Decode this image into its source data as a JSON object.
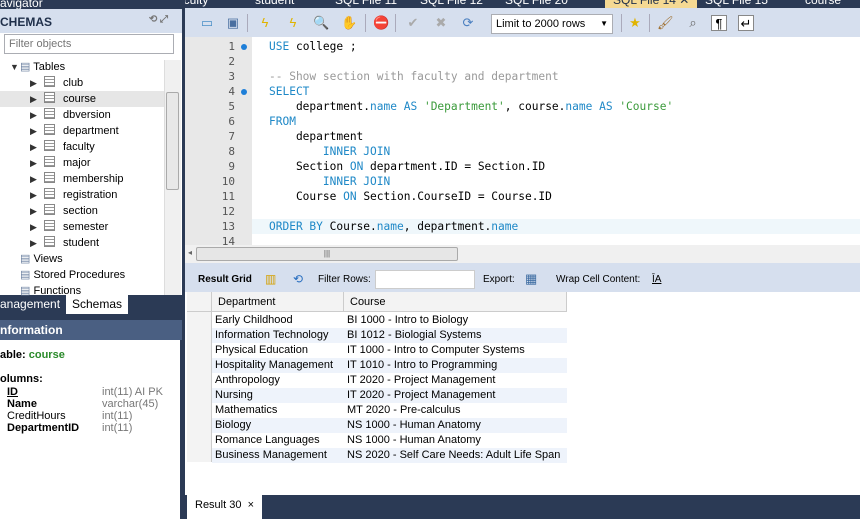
{
  "navigator": {
    "title": "avigator",
    "schemas_label": "CHEMAS",
    "filter_placeholder": "Filter objects",
    "tables_label": "Tables",
    "tables": [
      "club",
      "course",
      "dbversion",
      "department",
      "faculty",
      "major",
      "membership",
      "registration",
      "section",
      "semester",
      "student"
    ],
    "selected_table": "course",
    "other_nodes": [
      "Views",
      "Stored Procedures",
      "Functions"
    ],
    "tabs": [
      "anagement",
      "Schemas"
    ],
    "active_tab": "Schemas"
  },
  "information": {
    "title": "nformation",
    "table_label": "able:",
    "table_name": "course",
    "columns_label": "olumns:",
    "columns": [
      {
        "name": "ID",
        "type": "int(11) AI PK",
        "bold": true,
        "underline": true
      },
      {
        "name": "Name",
        "type": "varchar(45)",
        "bold": true
      },
      {
        "name": "CreditHours",
        "type": "int(11)",
        "bold": false
      },
      {
        "name": "DepartmentID",
        "type": "int(11)",
        "bold": true
      }
    ]
  },
  "editor_tabs": [
    "aculty",
    "student",
    "SQL File 11",
    "SQL File 12",
    "SQL File 20",
    "SQL File 14",
    "SQL File 15",
    "course"
  ],
  "active_editor_tab": "SQL File 14",
  "toolbar": {
    "limit": "Limit to 2000 rows"
  },
  "code": [
    [
      [
        "USE",
        "kw"
      ],
      [
        " college ;",
        "id"
      ]
    ],
    [],
    [
      [
        "-- Show section with faculty and department",
        "cm"
      ]
    ],
    [
      [
        "SELECT",
        "kw"
      ]
    ],
    [
      [
        "    department.",
        "id"
      ],
      [
        "name",
        "fn"
      ],
      [
        " AS ",
        "kw"
      ],
      [
        "'Department'",
        "st"
      ],
      [
        ", course.",
        "id"
      ],
      [
        "name",
        "fn"
      ],
      [
        " AS ",
        "kw"
      ],
      [
        "'Course'",
        "st"
      ]
    ],
    [
      [
        "FROM",
        "kw"
      ]
    ],
    [
      [
        "    department",
        "id"
      ]
    ],
    [
      [
        "        INNER JOIN",
        "kw"
      ]
    ],
    [
      [
        "    Section ",
        "id"
      ],
      [
        "ON",
        "kw"
      ],
      [
        " department.ID = Section.ID",
        "id"
      ]
    ],
    [
      [
        "        INNER JOIN",
        "kw"
      ]
    ],
    [
      [
        "    Course ",
        "id"
      ],
      [
        "ON",
        "kw"
      ],
      [
        " Section.CourseID = Course.ID",
        "id"
      ]
    ],
    [],
    [
      [
        "ORDER BY",
        "kw"
      ],
      [
        " Course.",
        "id"
      ],
      [
        "name",
        "fn"
      ],
      [
        ", department.",
        "id"
      ],
      [
        "name",
        "fn"
      ]
    ],
    []
  ],
  "result_toolbar": {
    "result_grid": "Result Grid",
    "filter_rows": "Filter Rows:",
    "export": "Export:",
    "wrap": "Wrap Cell Content:"
  },
  "grid": {
    "columns": [
      "Department",
      "Course"
    ],
    "rows": [
      [
        "Early Childhood",
        "BI 1000 - Intro to Biology"
      ],
      [
        "Information Technology",
        "BI 1012 - Biologial Systems"
      ],
      [
        "Physical Education",
        "IT 1000 - Intro to Computer Systems"
      ],
      [
        "Hospitality Management",
        "IT 1010 - Intro to Programming"
      ],
      [
        "Anthropology",
        "IT 2020 - Project Management"
      ],
      [
        "Nursing",
        "IT 2020 - Project Management"
      ],
      [
        "Mathematics",
        "MT 2020 - Pre-calculus"
      ],
      [
        "Biology",
        "NS 1000 - Human Anatomy"
      ],
      [
        "Romance Languages",
        "NS 1000 - Human Anatomy"
      ],
      [
        "Business Management",
        "NS 2020 - Self Care Needs: Adult Life Span"
      ]
    ]
  },
  "result_tab": {
    "label": "Result 30",
    "close": "×"
  }
}
